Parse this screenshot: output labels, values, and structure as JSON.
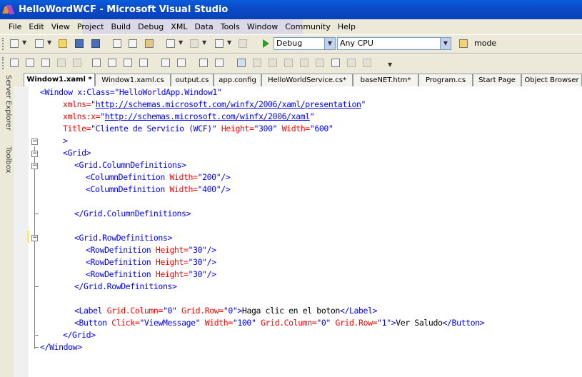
{
  "window": {
    "title": "HelloWordWCF - Microsoft Visual Studio"
  },
  "menu": [
    "File",
    "Edit",
    "View",
    "Project",
    "Build",
    "Debug",
    "XML",
    "Data",
    "Tools",
    "Window",
    "Community",
    "Help"
  ],
  "toolbar": {
    "config": "Debug",
    "platform": "Any CPU",
    "find_label": "mode"
  },
  "side_panels": [
    "Server Explorer",
    "Toolbox"
  ],
  "tabs": [
    "Window1.xaml *",
    "Window1.xaml.cs",
    "output.cs",
    "app.config",
    "HelloWorldService.cs*",
    "baseNET.htm*",
    "Program.cs",
    "Start Page",
    "Object Browser"
  ],
  "code": {
    "l1_open": "<Window x:Class=",
    "l1_val": "\"HelloWorldApp.Window1\"",
    "l2_attr": "xmlns=",
    "l2_url": "http://schemas.microsoft.com/winfx/2006/xaml/presentation",
    "l3_attr": "xmlns:x=",
    "l3_url": "http://schemas.microsoft.com/winfx/2006/xaml",
    "l4_a1": "Title=",
    "l4_v1": "\"Cliente de Servicio (WCF)\"",
    "l4_a2": "Height=",
    "l4_v2": "\"300\"",
    "l4_a3": "Width=",
    "l4_v3": "\"600\"",
    "l5": ">",
    "l6": "<Grid>",
    "l7": "<Grid.ColumnDefinitions>",
    "l8_tag": "<ColumnDefinition",
    "l8_attr": "Width=",
    "l8_val": "\"200\"",
    "l8_end": "/>",
    "l9_tag": "<ColumnDefinition",
    "l9_attr": "Width=",
    "l9_val": "\"400\"",
    "l9_end": "/>",
    "l11": "</Grid.ColumnDefinitions>",
    "l13": "<Grid.RowDefinitions>",
    "row_tag": "<RowDefinition",
    "row_attr": "Height=",
    "row_val": "\"30\"",
    "row_end": "/>",
    "l17": "</Grid.RowDefinitions>",
    "l19_tag": "<Label",
    "l19_a1": "Grid.Column=",
    "l19_v1": "\"0\"",
    "l19_a2": "Grid.Row=",
    "l19_v2": "\"0\"",
    "l19_gt": ">",
    "l19_text": "Haga clic en el boton",
    "l19_close": "</Label>",
    "l20_tag": "<Button",
    "l20_a1": "Click=",
    "l20_v1": "\"ViewMessage\"",
    "l20_a2": "Width=",
    "l20_v2": "\"100\"",
    "l20_a3": "Grid.Column=",
    "l20_v3": "\"0\"",
    "l20_a4": "Grid.Row=",
    "l20_v4": "\"1\"",
    "l20_gt": ">",
    "l20_text": "Ver Saludo",
    "l20_close": "</Button>",
    "l21": "</Grid>",
    "l22": "</Window>"
  }
}
